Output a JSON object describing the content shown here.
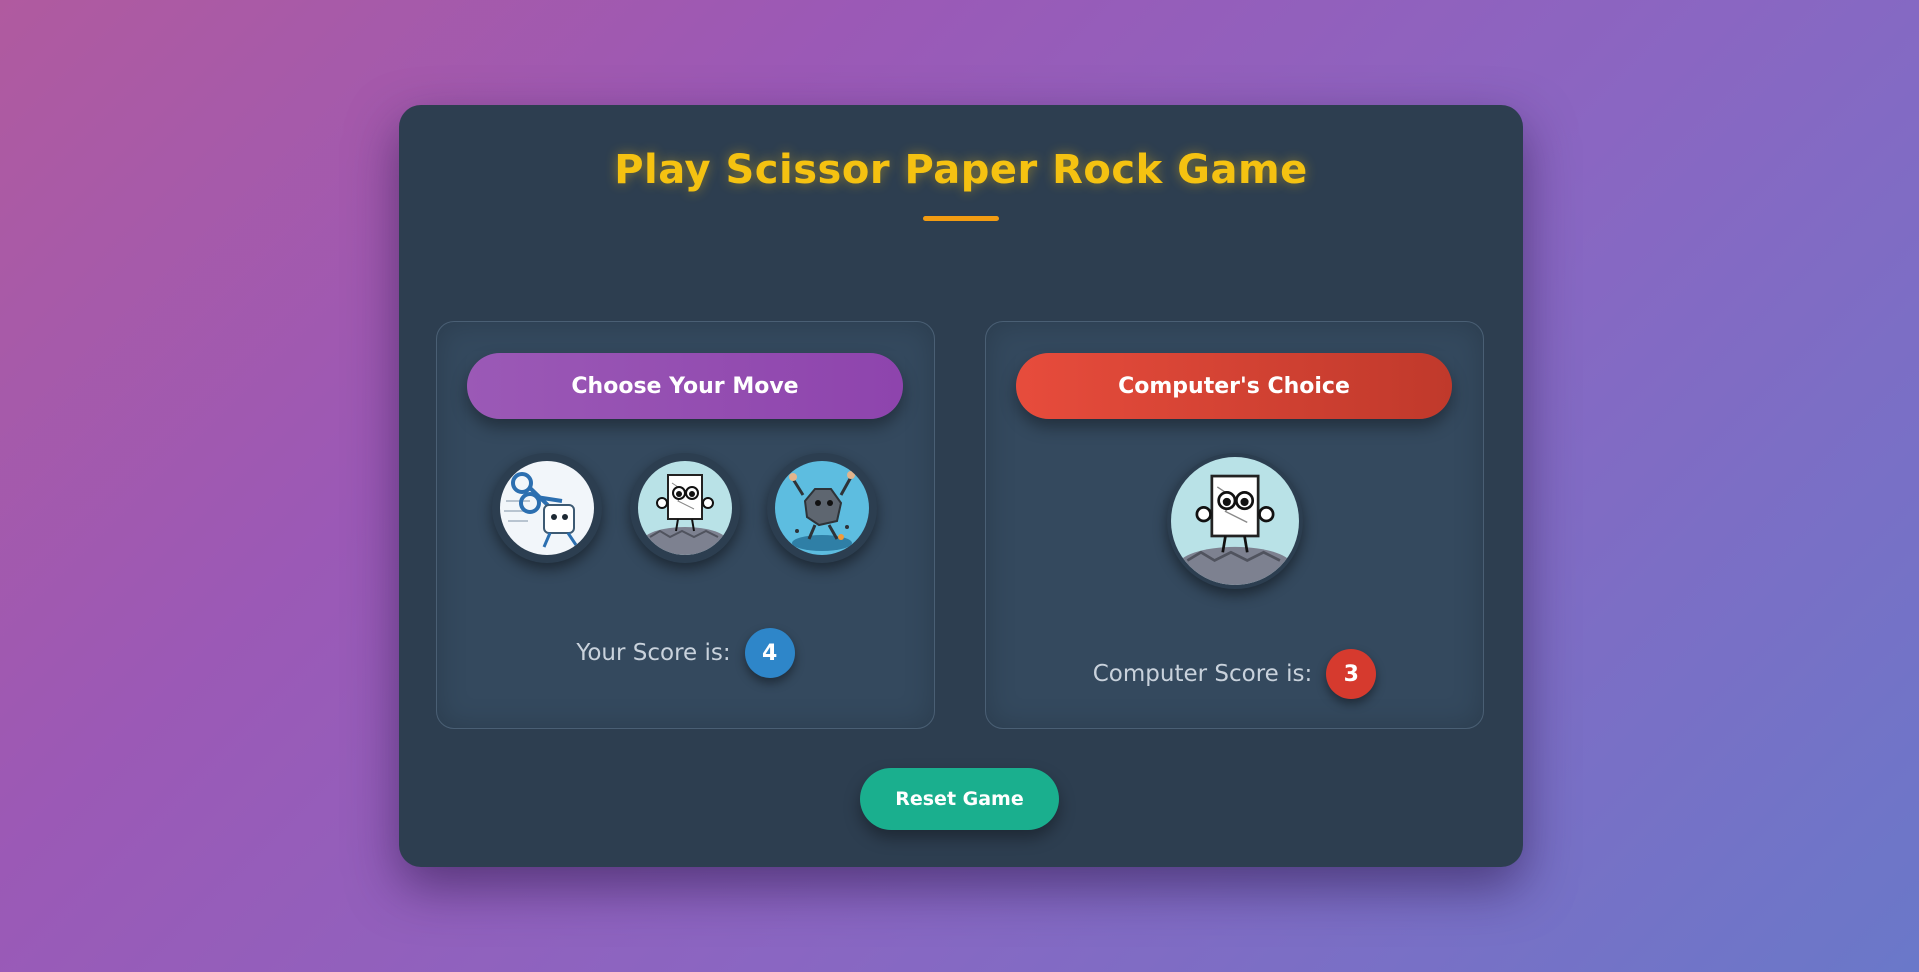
{
  "title": "Play Scissor Paper Rock Game",
  "player": {
    "header": "Choose Your Move",
    "choices": [
      {
        "name": "scissor",
        "icon": "scissor-character-icon"
      },
      {
        "name": "paper",
        "icon": "paper-character-icon"
      },
      {
        "name": "rock",
        "icon": "rock-character-icon"
      }
    ],
    "score_label": "Your Score is:",
    "score": "4"
  },
  "computer": {
    "header": "Computer's Choice",
    "current_choice": "paper",
    "current_choice_icon": "paper-character-icon",
    "score_label": "Computer Score is:",
    "score": "3"
  },
  "reset_label": "Reset Game",
  "colors": {
    "title": "#f5c211",
    "card": "#2d3e50",
    "player_header": "#9b59b6",
    "computer_header": "#e74c3c",
    "player_score": "#2e86c9",
    "computer_score": "#d63a2e",
    "reset": "#1aaf8e"
  }
}
